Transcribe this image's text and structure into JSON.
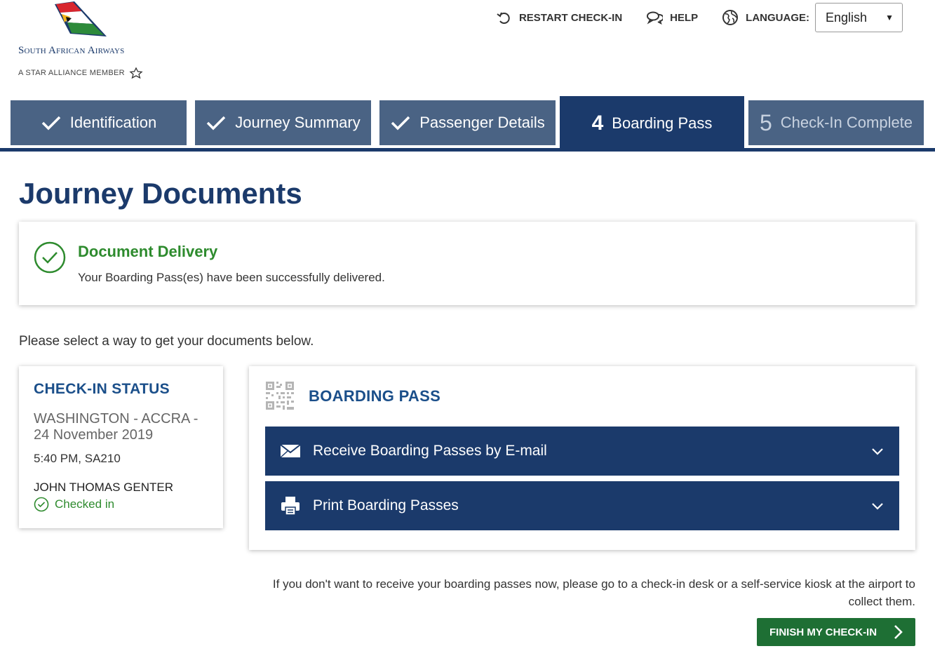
{
  "brand": {
    "name": "South African Airways",
    "tagline": "A STAR ALLIANCE MEMBER"
  },
  "topnav": {
    "restart": "RESTART CHECK-IN",
    "help": "HELP",
    "language_label": "LANGUAGE:",
    "language_value": "English"
  },
  "steps": [
    {
      "label": "Identification",
      "state": "done"
    },
    {
      "label": "Journey Summary",
      "state": "done"
    },
    {
      "label": "Passenger Details",
      "state": "done"
    },
    {
      "num": "4",
      "label": "Boarding Pass",
      "state": "active"
    },
    {
      "num": "5",
      "label": "Check-In Complete",
      "state": "future"
    }
  ],
  "page": {
    "title": "Journey Documents",
    "instruction": "Please select a way to get your documents below.",
    "note": "If you don't want to receive your boarding passes now, please go to a check-in desk or a self-service kiosk at the airport to collect them."
  },
  "delivery": {
    "title": "Document Delivery",
    "message": "Your Boarding Pass(es) have been successfully delivered."
  },
  "status": {
    "title": "CHECK-IN STATUS",
    "route": "WASHINGTON - ACCRA - 24 November 2019",
    "flight": "5:40 PM, SA210",
    "passenger": "JOHN THOMAS GENTER",
    "checked": "Checked in"
  },
  "boarding_pass": {
    "title": "BOARDING PASS",
    "email_option": "Receive Boarding Passes by E-mail",
    "print_option": "Print Boarding Passes"
  },
  "actions": {
    "finish": "FINISH MY CHECK-IN"
  },
  "colors": {
    "navy": "#1b3a6b",
    "step_inactive": "#4a6384",
    "success_green": "#2e8b2e",
    "finish_green": "#1e6f34",
    "heading_blue": "#1b4f8a"
  }
}
